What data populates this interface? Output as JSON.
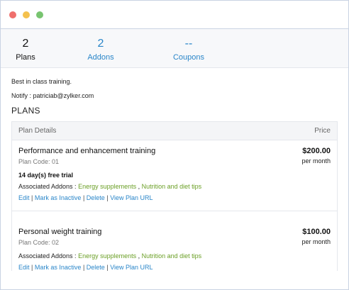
{
  "window_controls": {
    "close_color": "#ef6f6c",
    "minimize_color": "#f4c14e",
    "maximize_color": "#78c470"
  },
  "stats": [
    {
      "count": "2",
      "label": "Plans",
      "active": true
    },
    {
      "count": "2",
      "label": "Addons",
      "active": false
    },
    {
      "count": "--",
      "label": "Coupons",
      "active": false
    }
  ],
  "description": "Best in class training.",
  "notify": {
    "label": "Notify :",
    "email": "patriciab@zylker.com"
  },
  "plans_heading": "PLANS",
  "table": {
    "col_details": "Plan Details",
    "col_price": "Price"
  },
  "plans": [
    {
      "name": "Performance and enhancement training",
      "code": "Plan Code: 01",
      "price": "$200.00",
      "period": "per month",
      "trial": "14 day(s) free trial",
      "addons_label": "Associated Addons :",
      "addons": [
        "Energy supplements",
        "Nutrition and diet tips"
      ]
    },
    {
      "name": "Personal weight training",
      "code": "Plan Code: 02",
      "price": "$100.00",
      "period": "per month",
      "trial": "",
      "addons_label": "Associated Addons :",
      "addons": [
        "Energy supplements",
        "Nutrition and diet tips"
      ]
    }
  ],
  "actions": {
    "edit": "Edit",
    "inactive": "Mark as Inactive",
    "delete": "Delete",
    "view_url": "View Plan URL",
    "separator": "|"
  },
  "colors": {
    "link": "#2a86c9",
    "addon": "#6a9f25"
  }
}
